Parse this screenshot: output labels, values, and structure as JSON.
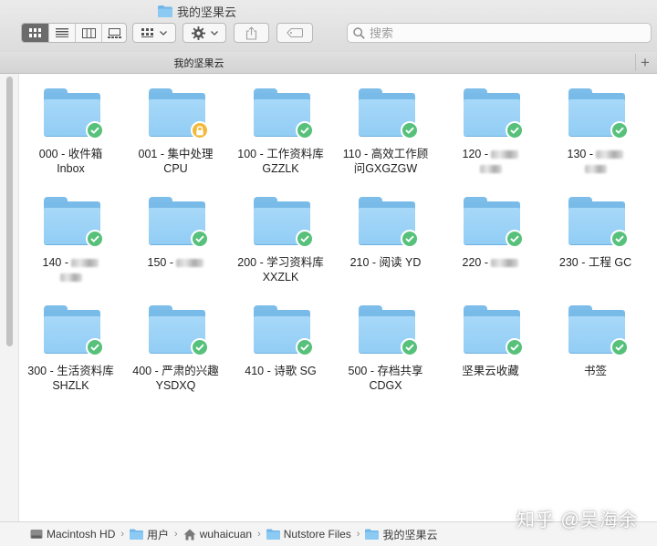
{
  "window": {
    "title": "我的坚果云"
  },
  "toolbar": {
    "search_placeholder": "搜索"
  },
  "tabbar": {
    "tab_title": "我的坚果云",
    "add_label": "+"
  },
  "folders": [
    {
      "line1": "000 - 收件箱",
      "line2": "Inbox",
      "status": "synced"
    },
    {
      "line1": "001 - 集中处理",
      "line2": "CPU",
      "status": "locked"
    },
    {
      "line1": "100 - 工作资料库",
      "line2": "GZZLK",
      "status": "synced"
    },
    {
      "line1": "110 - 高效工作顾",
      "line2": "问GXGZGW",
      "status": "synced"
    },
    {
      "line1": "120 - ",
      "line2": "",
      "status": "synced"
    },
    {
      "line1": "130 - ",
      "line2": "",
      "status": "synced"
    },
    {
      "line1": "140 - ",
      "line2": "",
      "status": "synced"
    },
    {
      "line1": "150 - ",
      "line2": "",
      "status": "synced"
    },
    {
      "line1": "200 - 学习资料库",
      "line2": "XXZLK",
      "status": "synced"
    },
    {
      "line1": "210 - 阅读 YD",
      "line2": "",
      "status": "synced"
    },
    {
      "line1": "220 - ",
      "line2": "",
      "status": "synced"
    },
    {
      "line1": "230 - 工程 GC",
      "line2": "",
      "status": "synced"
    },
    {
      "line1": "300 - 生活资料库",
      "line2": "SHZLK",
      "status": "synced"
    },
    {
      "line1": "400 - 严肃的兴趣",
      "line2": "YSDXQ",
      "status": "synced"
    },
    {
      "line1": "410 - 诗歌 SG",
      "line2": "",
      "status": "synced"
    },
    {
      "line1": "500 - 存档共享",
      "line2": "CDGX",
      "status": "synced"
    },
    {
      "line1": "坚果云收藏",
      "line2": "",
      "status": "synced"
    },
    {
      "line1": "书签",
      "line2": "",
      "status": "synced"
    }
  ],
  "pathbar": [
    {
      "label": "Macintosh HD",
      "icon": "hard-drive-icon"
    },
    {
      "label": "用户",
      "icon": "folder-icon"
    },
    {
      "label": "wuhaicuan",
      "icon": "home-icon"
    },
    {
      "label": "Nutstore Files",
      "icon": "folder-icon"
    },
    {
      "label": "我的坚果云",
      "icon": "folder-icon"
    }
  ],
  "watermark": "知乎 @吴海余",
  "colors": {
    "folder": "#92cdf5",
    "synced_badge": "#57c17b",
    "lock_badge": "#f3b93b"
  }
}
